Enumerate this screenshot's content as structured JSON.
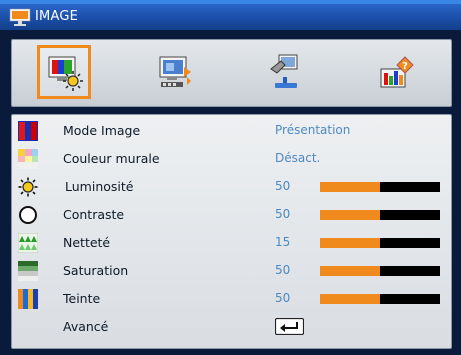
{
  "header": {
    "title": "IMAGE"
  },
  "tabs": [
    {
      "name": "image",
      "selected": true
    },
    {
      "name": "display",
      "selected": false
    },
    {
      "name": "setup",
      "selected": false
    },
    {
      "name": "options",
      "selected": false
    }
  ],
  "menu": {
    "items": [
      {
        "label": "Mode Image",
        "value": "Présentation",
        "icon": "color-mode-icon"
      },
      {
        "label": "Couleur murale",
        "value": "Désact.",
        "icon": "wall-color-icon"
      },
      {
        "label": "Luminosité",
        "value": "50",
        "level": 0.5,
        "icon": "brightness-icon"
      },
      {
        "label": "Contraste",
        "value": "50",
        "level": 0.5,
        "icon": "contrast-icon"
      },
      {
        "label": "Netteté",
        "value": "15",
        "level": 0.5,
        "icon": "sharpness-icon"
      },
      {
        "label": "Saturation",
        "value": "50",
        "level": 0.5,
        "icon": "saturation-icon"
      },
      {
        "label": "Teinte",
        "value": "50",
        "level": 0.5,
        "icon": "tint-icon"
      },
      {
        "label": "Avancé",
        "icon": "enter-icon"
      }
    ]
  },
  "colors": {
    "accent": "#f08a1c",
    "value_text": "#4d89c3",
    "title_bar": "#1a4ea8"
  }
}
